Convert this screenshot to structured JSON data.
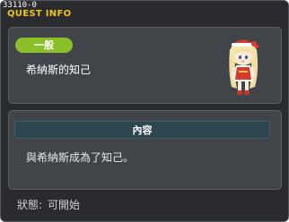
{
  "debug_id": "33110-0",
  "window": {
    "title": "QUEST INFO"
  },
  "quest": {
    "category": "一般",
    "name": "希納斯的知己"
  },
  "content": {
    "header": "內容",
    "text": "與希納斯成為了知己。"
  },
  "status": {
    "label": "狀態:",
    "value": "可開始"
  },
  "colors": {
    "title": "#f0c419",
    "badge": "#8bbf28",
    "window_bg": "#2a2b2f",
    "panel_bg": "#41454a",
    "content_header_bg": "#2e4650"
  },
  "icons": {
    "npc": "npc-portrait-icon"
  }
}
